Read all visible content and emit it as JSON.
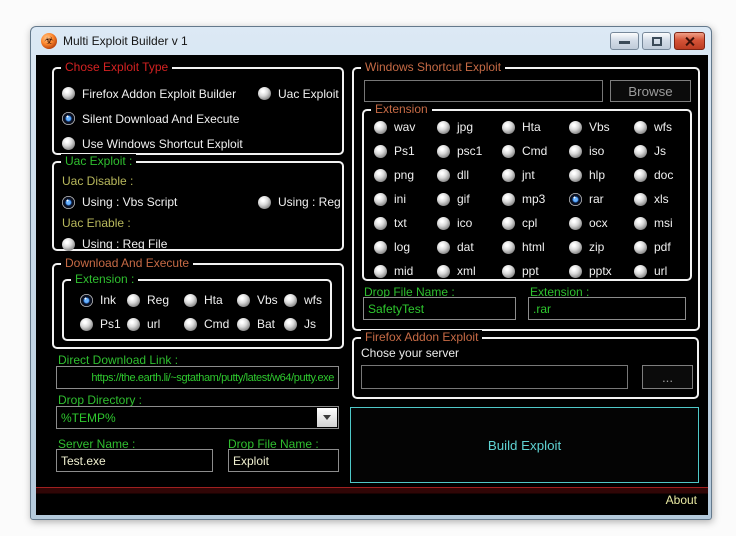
{
  "window": {
    "title": "Multi Exploit Builder v 1"
  },
  "groups": {
    "choose_exploit_type": {
      "title": "Chose Exploit Type",
      "options": [
        {
          "label": "Firefox Addon Exploit Builder",
          "selected": false
        },
        {
          "label": "Uac Exploit",
          "selected": false
        },
        {
          "label": "Silent Download And Execute",
          "selected": true
        },
        {
          "label": "Use Windows Shortcut Exploit",
          "selected": false
        }
      ]
    },
    "uac_exploit": {
      "title": "Uac Exploit :",
      "uac_disable_label": "Uac Disable :",
      "disable_options": [
        {
          "label": "Using : Vbs Script",
          "selected": true
        },
        {
          "label": "Using : Reg",
          "selected": false
        }
      ],
      "uac_enable_label": "Uac Enable :",
      "enable_options": [
        {
          "label": "Using : Reg File",
          "selected": false
        }
      ]
    },
    "download_and_execute": {
      "title": "Download And Execute",
      "extension": {
        "title": "Extension :",
        "options": [
          {
            "label": "Ink",
            "selected": true
          },
          {
            "label": "Reg",
            "selected": false
          },
          {
            "label": "Hta",
            "selected": false
          },
          {
            "label": "Vbs",
            "selected": false
          },
          {
            "label": "wfs",
            "selected": false
          },
          {
            "label": "Ps1",
            "selected": false
          },
          {
            "label": "url",
            "selected": false
          },
          {
            "label": "Cmd",
            "selected": false
          },
          {
            "label": "Bat",
            "selected": false
          },
          {
            "label": "Js",
            "selected": false
          }
        ]
      },
      "direct_download_link": {
        "label": "Direct Download Link :",
        "value": "https://the.earth.li/~sgtatham/putty/latest/w64/putty.exe"
      },
      "drop_directory": {
        "label": "Drop Directory :",
        "value": "%TEMP%"
      },
      "server_name": {
        "label": "Server Name :",
        "value": "Test.exe"
      },
      "drop_file_name": {
        "label": "Drop File Name :",
        "value": "Exploit"
      }
    },
    "windows_shortcut_exploit": {
      "title": "Windows Shortcut Exploit",
      "target_path_value": "",
      "browse_label": "Browse",
      "extension": {
        "title": "Extension",
        "options": [
          {
            "label": "wav",
            "selected": false
          },
          {
            "label": "jpg",
            "selected": false
          },
          {
            "label": "Hta",
            "selected": false
          },
          {
            "label": "Vbs",
            "selected": false
          },
          {
            "label": "wfs",
            "selected": false
          },
          {
            "label": "Ps1",
            "selected": false
          },
          {
            "label": "psc1",
            "selected": false
          },
          {
            "label": "Cmd",
            "selected": false
          },
          {
            "label": "iso",
            "selected": false
          },
          {
            "label": "Js",
            "selected": false
          },
          {
            "label": "png",
            "selected": false
          },
          {
            "label": "dll",
            "selected": false
          },
          {
            "label": "jnt",
            "selected": false
          },
          {
            "label": "hlp",
            "selected": false
          },
          {
            "label": "doc",
            "selected": false
          },
          {
            "label": "ini",
            "selected": false
          },
          {
            "label": "gif",
            "selected": false
          },
          {
            "label": "mp3",
            "selected": false
          },
          {
            "label": "rar",
            "selected": true
          },
          {
            "label": "xls",
            "selected": false
          },
          {
            "label": "txt",
            "selected": false
          },
          {
            "label": "ico",
            "selected": false
          },
          {
            "label": "cpl",
            "selected": false
          },
          {
            "label": "ocx",
            "selected": false
          },
          {
            "label": "msi",
            "selected": false
          },
          {
            "label": "log",
            "selected": false
          },
          {
            "label": "dat",
            "selected": false
          },
          {
            "label": "html",
            "selected": false
          },
          {
            "label": "zip",
            "selected": false
          },
          {
            "label": "pdf",
            "selected": false
          },
          {
            "label": "mid",
            "selected": false
          },
          {
            "label": "xml",
            "selected": false
          },
          {
            "label": "ppt",
            "selected": false
          },
          {
            "label": "pptx",
            "selected": false
          },
          {
            "label": "url",
            "selected": false
          }
        ]
      },
      "drop_file_name": {
        "label": "Drop File Name :",
        "value": "SafetyTest"
      },
      "extension_field": {
        "label": "Extension :",
        "value": ".rar"
      }
    },
    "firefox_addon_exploit": {
      "title": "Firefox Addon Exploit",
      "server_label": "Chose your server",
      "server_value": "",
      "browse_label": "..."
    }
  },
  "build_button_label": "Build Exploit",
  "about_label": "About",
  "icons": {
    "app_icon": "biohazard",
    "app_icon_glyph": "☣"
  },
  "colors": {
    "red-title": "#d42222",
    "orange-title": "#c66a45",
    "green": "#2fbf2f",
    "khaki": "#b8b85c",
    "cyan": "#4fc8c8",
    "about": "#e9e9a2",
    "radio-selected-blue": "#3d8fe0",
    "divider-red": "#a02020"
  }
}
